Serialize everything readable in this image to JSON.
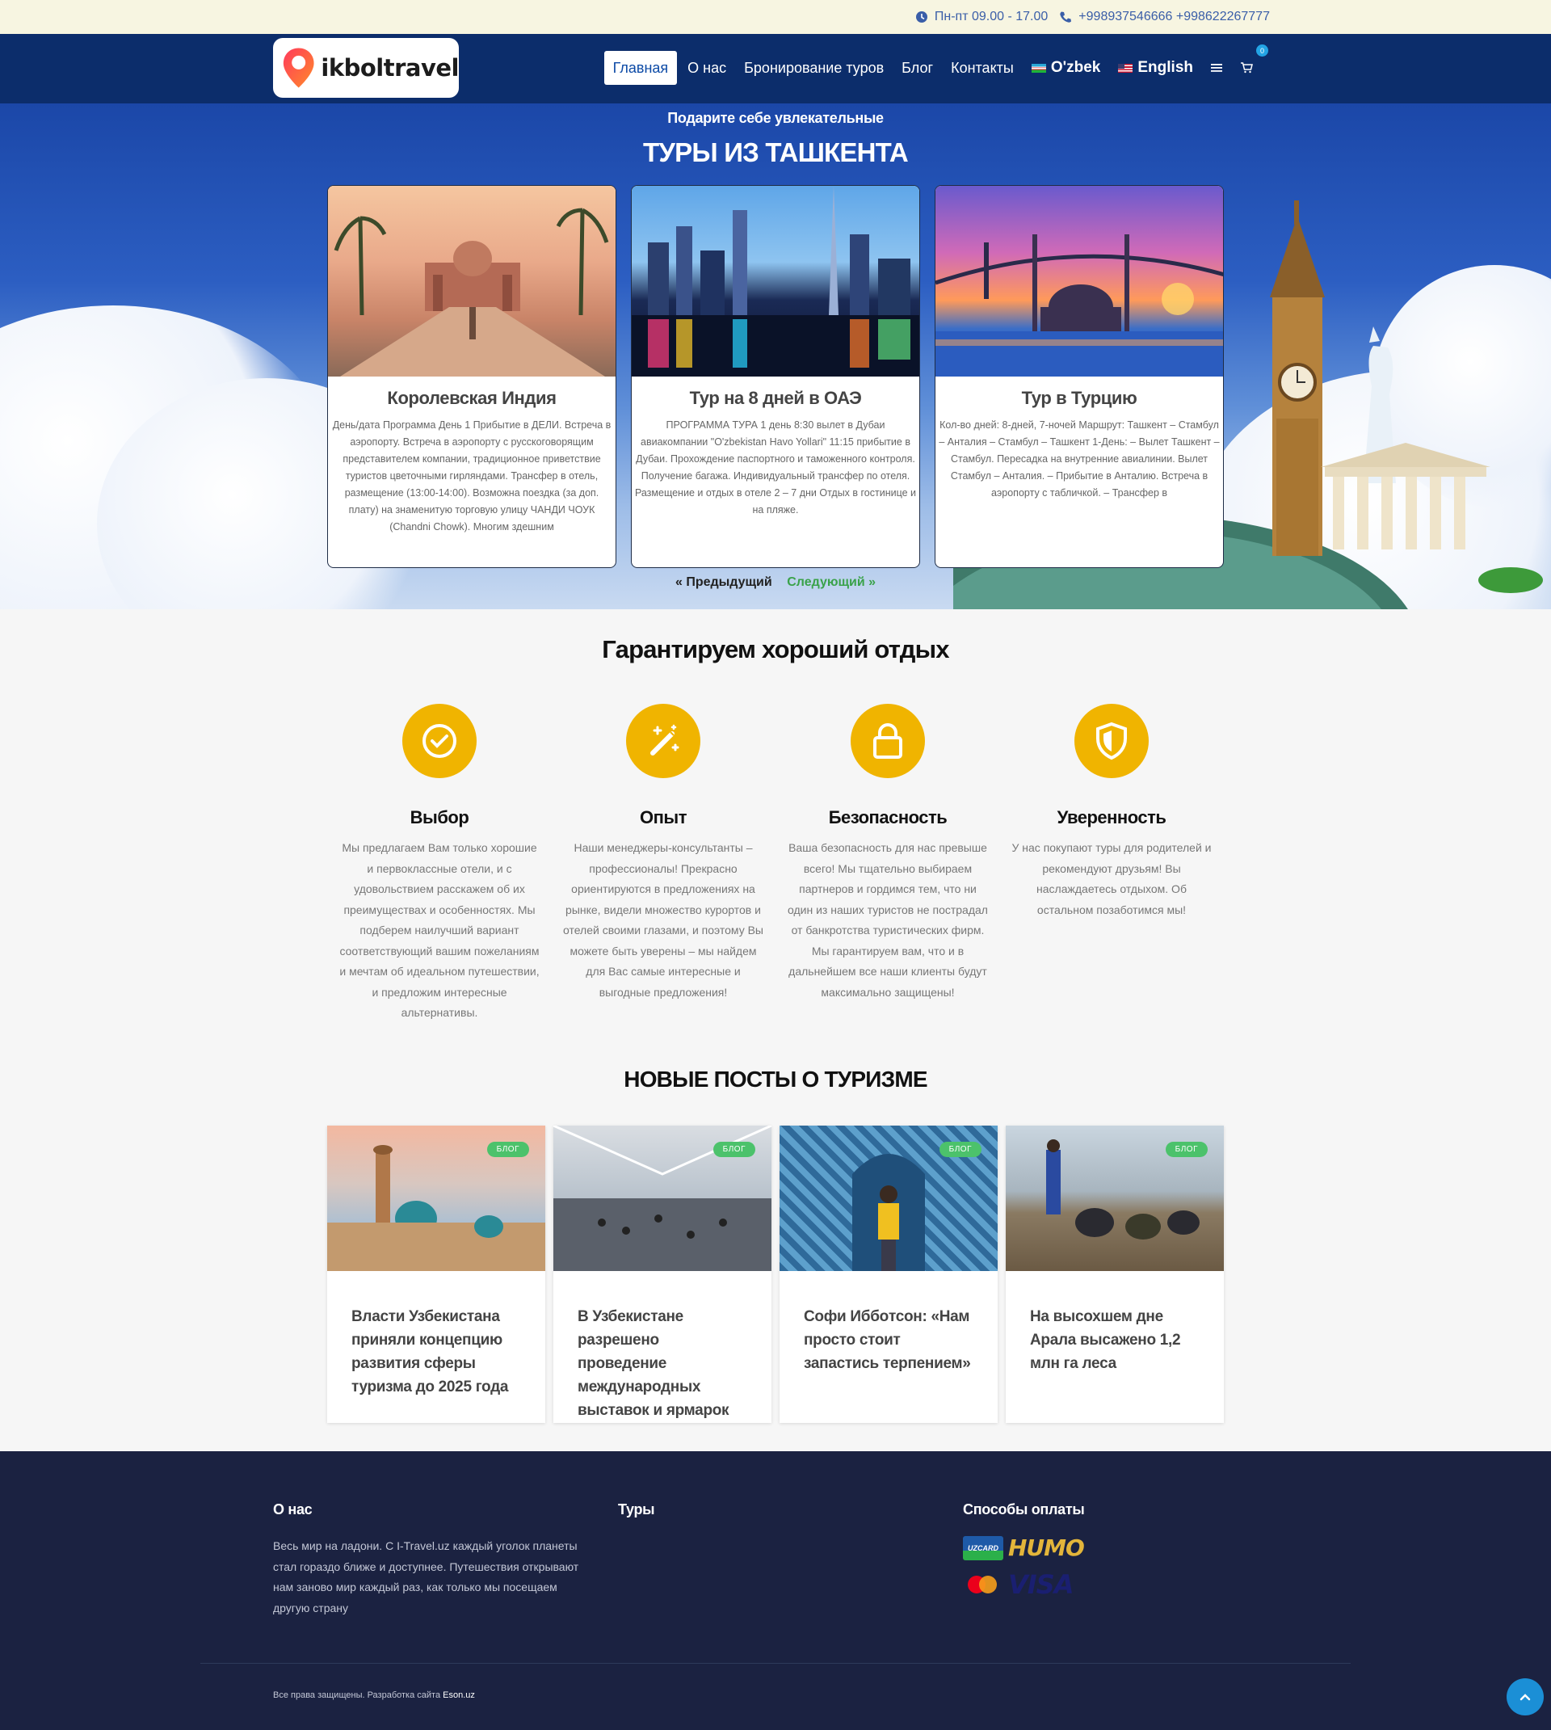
{
  "topbar": {
    "hours": "Пн-пт 09.00 - 17.00",
    "phones": "+998937546666 +998622267777",
    "clock_icon": "clock-icon",
    "phone_icon": "phone-icon"
  },
  "nav": {
    "logo_text": "ikboltravel",
    "items": [
      {
        "label": "Главная",
        "active": true
      },
      {
        "label": "О нас"
      },
      {
        "label": "Бронирование туров"
      },
      {
        "label": "Блог"
      },
      {
        "label": "Контакты"
      }
    ],
    "lang_uz": "O'zbek",
    "lang_en": "English",
    "cart_count": "0"
  },
  "hero": {
    "subtitle": "Подарите себе увлекательные",
    "title": "ТУРЫ ИЗ ТАШКЕНТА",
    "tours": [
      {
        "name": "Королевская Индия",
        "desc": "День/дата Программа День 1 Прибытие в ДЕЛИ. Встреча в аэропорту. Встреча в аэропорту с русскоговорящим  представителем компании, традиционное приветствие туристов цветочными гирляндами. Трансфер в отель, размещение (13:00-14:00). Возможна поездка (за доп. плату) на знаменитую торговую улицу ЧАНДИ ЧОУК (Chandni Chowk). Многим здешним"
      },
      {
        "name": "Тур на 8 дней в ОАЭ",
        "desc": "ПРОГРАММА ТУРА 1 день 8:30      вылет в Дубаи авиакомпании \"O'zbekistan Havo Yollari\" 11:15    прибытие в Дубаи.  Прохождение паспортного и таможенного контроля.  Получение багажа.  Индивидуальный трансфер по отеля.  Размещение и отдых в отеле 2 – 7 дни Отдых в гостинице и на пляже."
      },
      {
        "name": "Тур в Турцию",
        "desc": "Кол-во дней: 8-дней, 7-ночей Маршрут: Ташкент – Стамбул – Анталия – Стамбул – Ташкент   1-День: – Вылет Ташкент – Стамбул. Пересадка на внутренние авиалинии. Вылет Стамбул – Анталия. – Прибытие в Анталию. Встреча в аэропорту с табличкой. – Трансфер в"
      }
    ],
    "prev": "« Предыдущий",
    "next": "Следующий »"
  },
  "features": {
    "title": "Гарантируем хороший отдых",
    "items": [
      {
        "icon": "check-circle-icon",
        "name": "Выбор",
        "text": "Мы предлагаем Вам только хорошие и первоклассные отели, и с удовольствием расскажем об их преимуществах и особенностях. Мы подберем наилучший вариант соответствующий вашим пожеланиям и мечтам об идеальном путешествии, и предложим интересные альтернативы."
      },
      {
        "icon": "magic-wand-icon",
        "name": "Опыт",
        "text": "Наши менеджеры-консультанты – профессионалы! Прекрасно ориентируются в предложениях на рынке, видели множество курортов и отелей своими глазами, и поэтому Вы можете быть уверены – мы найдем для Вас самые интересные и выгодные предложения!"
      },
      {
        "icon": "lock-icon",
        "name": "Безопасность",
        "text": "Ваша безопасность для нас превыше всего! Мы тщательно выбираем партнеров и гордимся тем, что ни один из наших туристов не пострадал от банкротства туристических фирм. Мы гарантируем вам, что и в дальнейшем все наши клиенты будут максимально защищены!"
      },
      {
        "icon": "shield-icon",
        "name": "Уверенность",
        "text": "У нас покупают туры для родителей и рекомендуют друзьям! Вы наслаждаетесь отдыхом. Об остальном позаботимся мы!"
      }
    ]
  },
  "posts": {
    "title": "НОВЫЕ ПОСТЫ О ТУРИЗМЕ",
    "badge": "БЛОГ",
    "items": [
      {
        "title": "Власти Узбекистана приняли концепцию развития сферы туризма до 2025 года"
      },
      {
        "title": "В Узбекистане разрешено проведение международных выставок и ярмарок"
      },
      {
        "title": "Софи Иббoтсон: «Нам просто стоит запастись терпением»"
      },
      {
        "title": "На высохшем дне Арала высажено 1,2 млн га леса"
      }
    ]
  },
  "footer": {
    "about_title": "О нас",
    "about_text": "Весь мир на ладони. С I-Travel.uz каждый уголок планеты стал гораздо ближе и доступнее. Путешествия открывают нам заново мир каждый раз, как только мы посещаем другую страну",
    "tours_title": "Туры",
    "payments_title": "Способы оплаты",
    "payments": [
      "UZCARD",
      "HUMO",
      "Mastercard",
      "VISA"
    ],
    "copyright_text": "Все права защищены. Разработка сайта ",
    "copyright_link": "Eson.uz"
  },
  "colors": {
    "nav_bg": "#0c2d6b",
    "accent_yellow": "#f0b400",
    "badge_green": "#4cc26b",
    "footer_bg": "#1b2241"
  }
}
